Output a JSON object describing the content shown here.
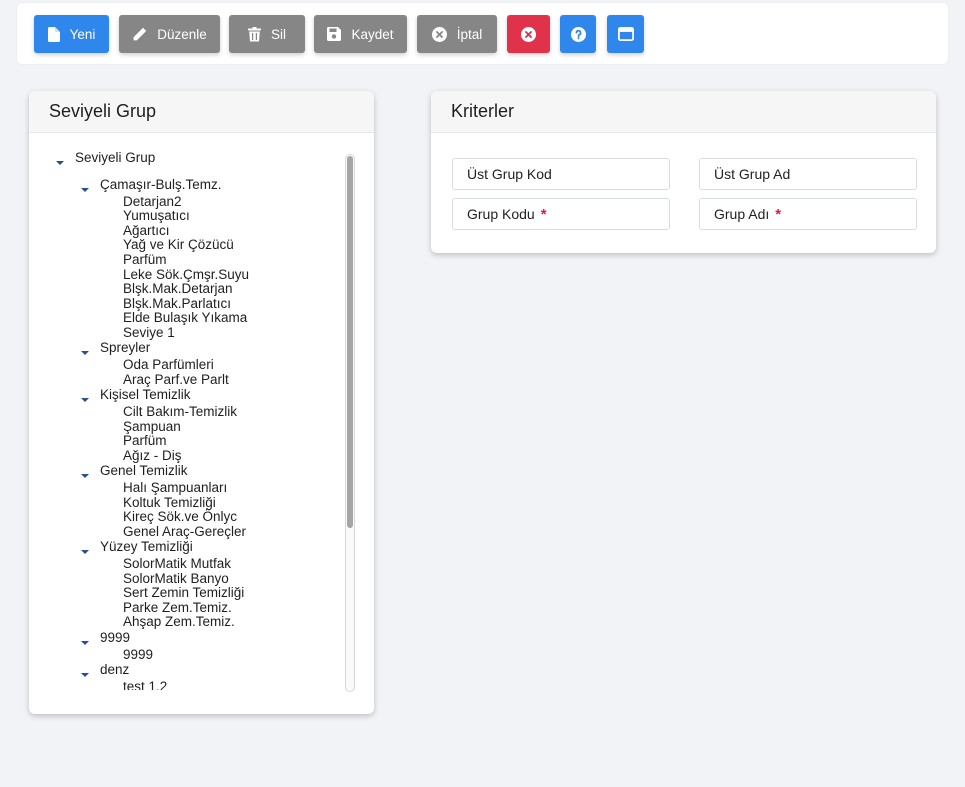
{
  "toolbar": {
    "new_label": "Yeni",
    "edit_label": "Düzenle",
    "delete_label": "Sil",
    "save_label": "Kaydet",
    "cancel_label": "İptal"
  },
  "colors": {
    "blue": "#2f86eb",
    "gray": "#868686",
    "red": "#e0324a"
  },
  "tree_panel": {
    "title": "Seviyeli Grup",
    "tree": [
      {
        "label": "Seviyeli Grup",
        "level": 0,
        "expanded": true
      },
      {
        "label": "Çamaşır-Bulş.Temz.",
        "level": 1,
        "expanded": true
      },
      {
        "label": "Detarjan2",
        "level": 2
      },
      {
        "label": "Yumuşatıcı",
        "level": 2
      },
      {
        "label": "Ağartıcı",
        "level": 2
      },
      {
        "label": "Yağ ve Kir Çözücü",
        "level": 2
      },
      {
        "label": "Parfüm",
        "level": 2
      },
      {
        "label": "Leke Sök.Çmşr.Suyu",
        "level": 2
      },
      {
        "label": "Blşk.Mak.Detarjan",
        "level": 2
      },
      {
        "label": "Blşk.Mak.Parlatıcı",
        "level": 2
      },
      {
        "label": "Elde Bulaşık Yıkama",
        "level": 2
      },
      {
        "label": "Seviye 1",
        "level": 2
      },
      {
        "label": "Spreyler",
        "level": 1,
        "expanded": true
      },
      {
        "label": "Oda Parfümleri",
        "level": 2
      },
      {
        "label": "Araç Parf.ve Parlt",
        "level": 2
      },
      {
        "label": "Kişisel Temizlik",
        "level": 1,
        "expanded": true
      },
      {
        "label": "Cilt Bakım-Temizlik",
        "level": 2
      },
      {
        "label": "Şampuan",
        "level": 2
      },
      {
        "label": "Parfüm",
        "level": 2
      },
      {
        "label": "Ağız - Diş",
        "level": 2
      },
      {
        "label": "Genel Temizlik",
        "level": 1,
        "expanded": true
      },
      {
        "label": "Halı Şampuanları",
        "level": 2
      },
      {
        "label": "Koltuk Temizliği",
        "level": 2
      },
      {
        "label": "Kireç Sök.ve Önlyc",
        "level": 2
      },
      {
        "label": "Genel Araç-Gereçler",
        "level": 2
      },
      {
        "label": "Yüzey Temizliği",
        "level": 1,
        "expanded": true
      },
      {
        "label": "SolorMatik Mutfak",
        "level": 2
      },
      {
        "label": "SolorMatik Banyo",
        "level": 2
      },
      {
        "label": "Sert Zemin Temizliği",
        "level": 2
      },
      {
        "label": "Parke Zem.Temiz.",
        "level": 2
      },
      {
        "label": "Ahşap Zem.Temiz.",
        "level": 2
      },
      {
        "label": "9999",
        "level": 1,
        "expanded": true
      },
      {
        "label": "9999",
        "level": 2
      },
      {
        "label": "denz",
        "level": 1,
        "expanded": true
      },
      {
        "label": "test 1.2",
        "level": 2
      }
    ]
  },
  "criteria_panel": {
    "title": "Kriterler",
    "ust_grup_kod": "Üst Grup Kod",
    "ust_grup_ad": "Üst Grup Ad",
    "grup_kodu": "Grup Kodu",
    "grup_adi": "Grup Adı",
    "required_mark": "*"
  }
}
